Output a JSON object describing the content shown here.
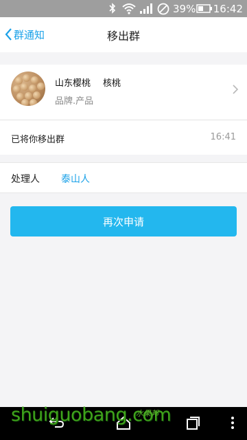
{
  "status_bar": {
    "battery_percent": "39%",
    "time": "16:42",
    "icons": [
      "bluetooth-icon",
      "wifi-icon",
      "signal-icon",
      "dnd-icon",
      "battery-icon"
    ]
  },
  "header": {
    "back_label": "群通知",
    "title": "移出群"
  },
  "group": {
    "name_part1": "山东樱桃",
    "name_part2": "核桃",
    "category": "品牌.产品"
  },
  "notice": {
    "text": "已将你移出群",
    "time": "16:41"
  },
  "handler": {
    "label": "处理人",
    "name": "泰山人"
  },
  "actions": {
    "reapply_label": "再次申请"
  },
  "watermark": {
    "text": "shuiguobang.com",
    "sub": "水果邦"
  },
  "colors": {
    "accent": "#1aa1e8",
    "button": "#23b7ee",
    "status_bar": "#9e9e9e"
  }
}
